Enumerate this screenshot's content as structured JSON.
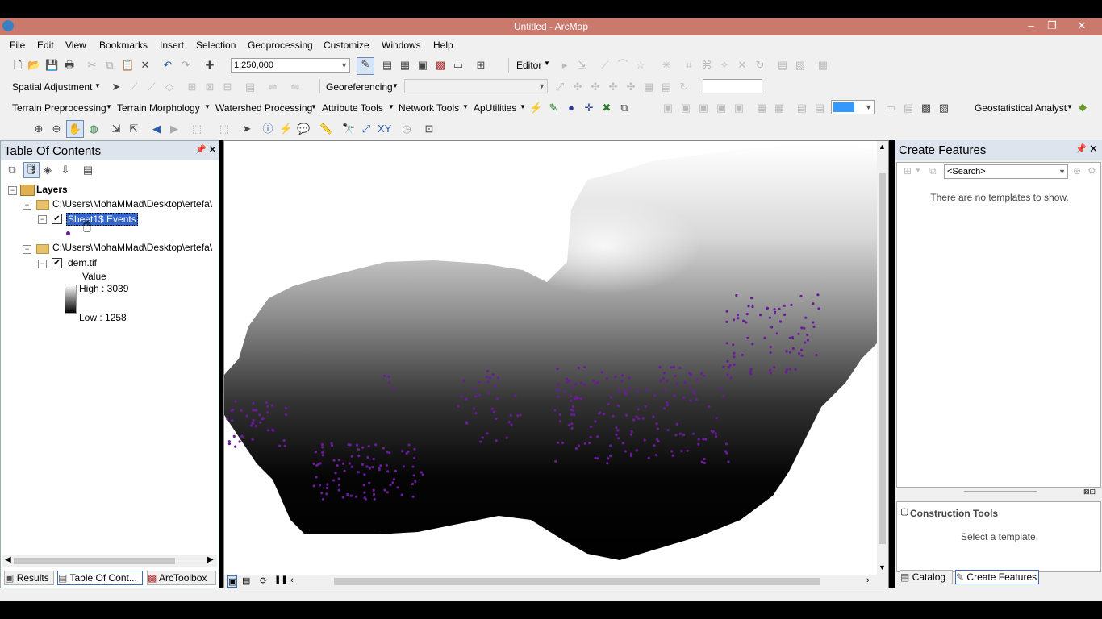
{
  "window": {
    "title": "Untitled - ArcMap",
    "minimize": "–",
    "maximize": "❐",
    "close": "✕"
  },
  "menu": [
    "File",
    "Edit",
    "View",
    "Bookmarks",
    "Insert",
    "Selection",
    "Geoprocessing",
    "Customize",
    "Windows",
    "Help"
  ],
  "standard_toolbar": {
    "scale": "1:250,000",
    "editor_label": "Editor"
  },
  "toolbar2": {
    "spatial_adjustment": "Spatial Adjustment",
    "georeferencing": "Georeferencing"
  },
  "toolbar3": {
    "terrain_preprocessing": "Terrain Preprocessing",
    "terrain_morphology": "Terrain Morphology",
    "watershed_processing": "Watershed Processing",
    "attribute_tools": "Attribute Tools",
    "network_tools": "Network Tools",
    "aputilities": "ApUtilities",
    "geostatistical_analyst": "Geostatistical Analyst"
  },
  "toc": {
    "title": "Table Of Contents",
    "layers_label": "Layers",
    "group1_path": "C:\\Users\\MohaMMad\\Desktop\\ertefa\\",
    "layer1_name": "Sheet1$ Events",
    "group2_path": "C:\\Users\\MohaMMad\\Desktop\\ertefa\\",
    "layer2_name": "dem.tif",
    "legend_title": "Value",
    "high": "High : 3039",
    "low": "Low : 1258"
  },
  "bottom_tabs_left": [
    "Results",
    "Table Of Cont...",
    "ArcToolbox"
  ],
  "create_features": {
    "title": "Create Features",
    "search_placeholder": "<Search>",
    "no_templates": "There are no templates to show.",
    "construction_tools": "Construction Tools",
    "select_template": "Select a template."
  },
  "bottom_tabs_right": [
    "Catalog",
    "Create Features"
  ],
  "map": {
    "raster_high": "#ffffff",
    "raster_low": "#000000",
    "point_color": "#6a1b9a"
  }
}
